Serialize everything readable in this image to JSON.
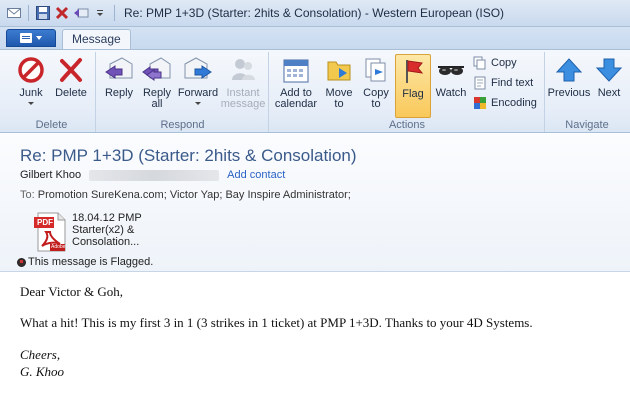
{
  "window": {
    "title": "Re: PMP 1+3D (Starter: 2hits & Consolation)  - Western European (ISO)"
  },
  "tabs": {
    "message": "Message"
  },
  "ribbon": {
    "delete_group": {
      "label": "Delete",
      "junk": "Junk",
      "delete": "Delete"
    },
    "respond_group": {
      "label": "Respond",
      "reply": "Reply",
      "reply_all_1": "Reply",
      "reply_all_2": "all",
      "forward": "Forward",
      "instant_1": "Instant",
      "instant_2": "message"
    },
    "actions_group": {
      "label": "Actions",
      "add_calendar_1": "Add to",
      "add_calendar_2": "calendar",
      "move_1": "Move",
      "move_2": "to",
      "copy_1": "Copy",
      "copy_2": "to",
      "flag": "Flag",
      "watch": "Watch",
      "copy_small": "Copy",
      "find_text": "Find text",
      "encoding": "Encoding"
    },
    "navigate_group": {
      "label": "Navigate",
      "previous": "Previous",
      "next": "Next"
    }
  },
  "message": {
    "subject": "Re: PMP 1+3D (Starter: 2hits & Consolation)",
    "sender": "Gilbert Khoo",
    "add_contact": "Add contact",
    "to_label": "To:",
    "to": "Promotion SureKena.com; Victor Yap; Bay Inspire Administrator;",
    "attachment": {
      "line1": "18.04.12 PMP",
      "line2": "Starter(x2) &",
      "line3": "Consolation...",
      "badge": "Adobe"
    },
    "flag_status": "This message is Flagged.",
    "body": {
      "greeting": "Dear Victor & Goh,",
      "para1": "What a hit! This is my first 3 in 1 (3 strikes in 1 ticket) at PMP 1+3D. Thanks to your 4D Systems.",
      "sign1": "Cheers,",
      "sign2": "G. Khoo"
    }
  },
  "colors": {
    "accent": "#3a5a8a",
    "link": "#2a63c4",
    "flag_active": "#f9c85a"
  }
}
